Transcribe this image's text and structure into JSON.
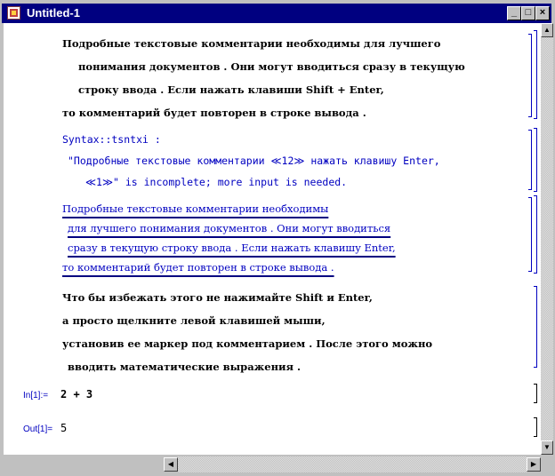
{
  "window": {
    "title": "Untitled-1",
    "min_glyph": "_",
    "max_glyph": "□",
    "close_glyph": "×"
  },
  "cell1": {
    "lines": [
      "Подробные текстовые комментарии необходимы для лучшего",
      "понимания документов .  Они могут вводиться сразу в текущую",
      "строку ввода .  Если нажать клавиши Shift + Enter,",
      "то комментарий будет повторен в строке вывода ."
    ]
  },
  "cell2": {
    "lines": [
      "Syntax::tsntxi :",
      "\"Подробные текстовые комментарии ≪12≫ нажать клавишу Enter,",
      "≪1≫\" is incomplete; more input is needed."
    ]
  },
  "cell3": {
    "lines": [
      "Подробные текстовые комментарии необходимы",
      "для лучшего понимания документов . Они могут вводиться",
      "сразу в текущую строку ввода . Если нажать клавишу Enter,",
      "то комментарий будет повторен в строке вывода ."
    ]
  },
  "cell4": {
    "lines": [
      "Что бы избежать этого не нажимайте Shift и Enter,",
      "а просто щелкните левой клавишей мыши,",
      "установив ее маркер под комментарием . После этого можно",
      "вводить математические выражения ."
    ]
  },
  "in_cell": {
    "label": "In[1]:=",
    "expr": "2 + 3"
  },
  "out_cell": {
    "label": "Out[1]=",
    "value": "5"
  },
  "colors": {
    "title_bar": "#000080",
    "input_blue": "#0000c0"
  }
}
